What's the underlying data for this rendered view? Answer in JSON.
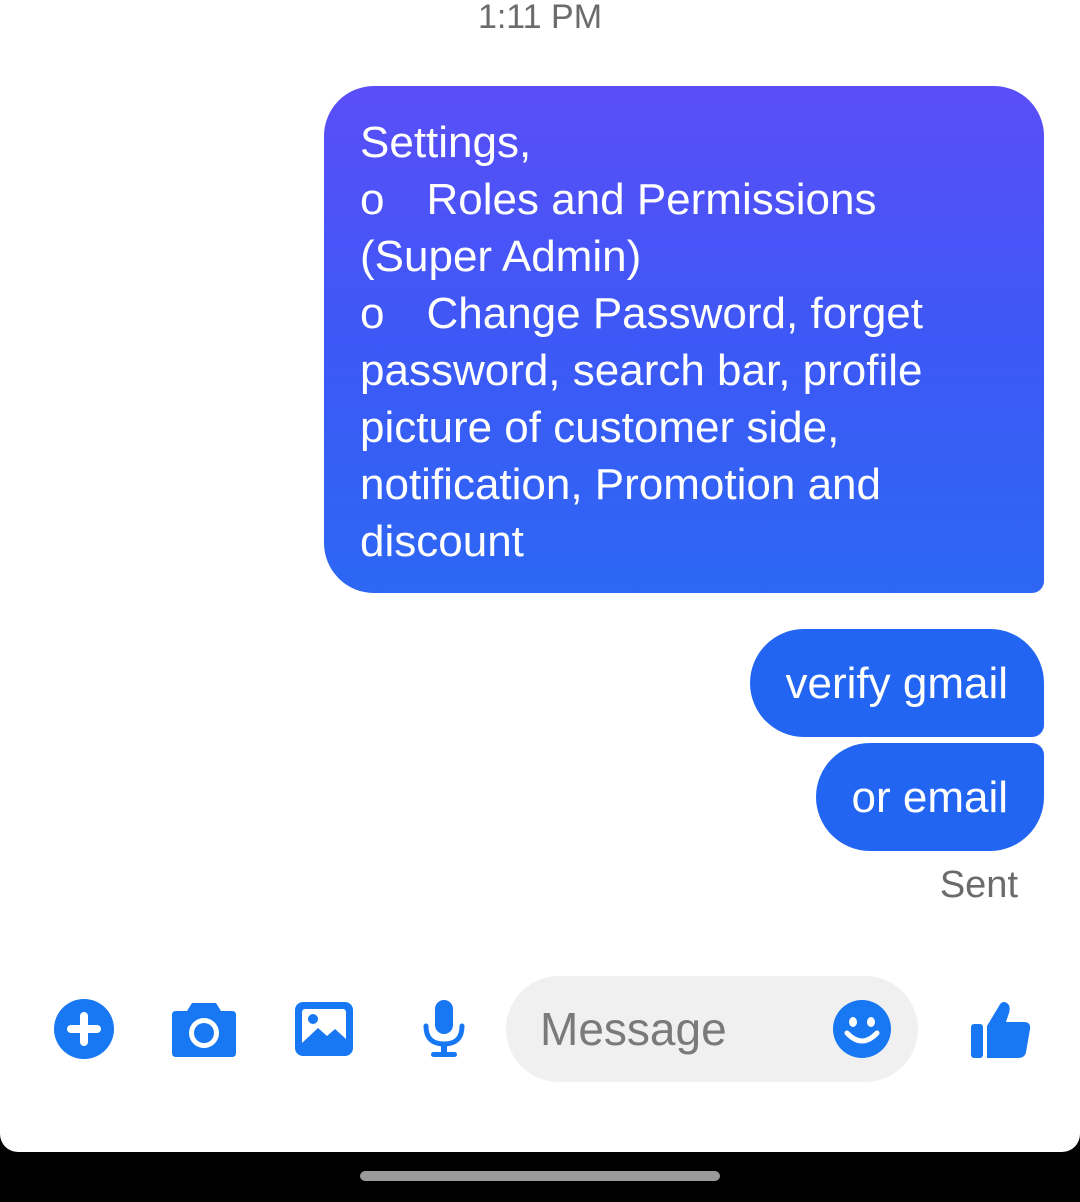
{
  "conversation": {
    "timestamp": "1:11 PM",
    "messages": [
      {
        "lines": [
          {
            "text": "Settings,"
          },
          {
            "bullet": "o",
            "text": "Roles and Permissions"
          },
          {
            "text": "(Super Admin)"
          },
          {
            "bullet": "o",
            "text": "Change Password, forget"
          },
          {
            "text": "password, search bar, profile"
          },
          {
            "text": "picture of customer side,"
          },
          {
            "text": "notification, Promotion and"
          },
          {
            "text": "discount"
          }
        ]
      },
      {
        "text": "verify gmail"
      },
      {
        "text": "or email"
      }
    ],
    "status": "Sent"
  },
  "composer": {
    "placeholder": "Message",
    "icons": [
      "plus-circle-icon",
      "camera-icon",
      "image-icon",
      "microphone-icon",
      "emoji-icon",
      "thumbs-up-icon"
    ]
  },
  "colors": {
    "accent": "#1877f2",
    "bubble_top": "#5a4ef8",
    "bubble_bottom": "#2d67f4",
    "bubble_solid": "#2265f2"
  }
}
